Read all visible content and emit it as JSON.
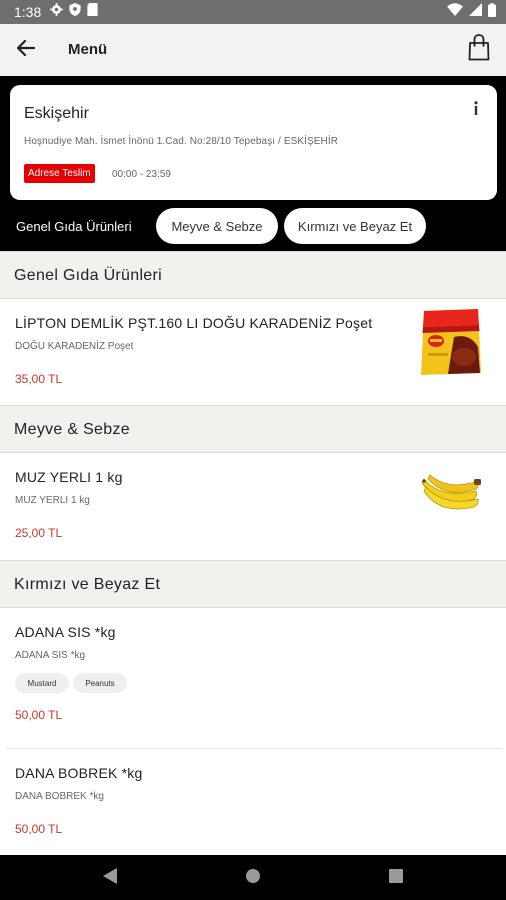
{
  "status_bar": {
    "time": "1:38",
    "icons_left": [
      "gear-icon",
      "shield-icon",
      "sim-card-icon"
    ],
    "icons_right": [
      "wifi-icon",
      "signal-icon",
      "battery-icon"
    ]
  },
  "app_bar": {
    "title": "Menü",
    "back_icon": "arrow-left-icon",
    "cart_icon": "shopping-bag-icon"
  },
  "store": {
    "name": "Eskişehir",
    "address": "Hoşnudiye Mah. İsmet İnönü 1.Cad. No:28/10  Tepebaşı / ESKİŞEHİR",
    "delivery_label": "Adrese Teslim",
    "hours": "00:00 - 23:59",
    "info_icon": "info-icon"
  },
  "categories": [
    {
      "label": "Genel Gıda Ürünleri",
      "selected": true
    },
    {
      "label": "Meyve & Sebze",
      "selected": false
    },
    {
      "label": "Kırmızı ve Beyaz Et",
      "selected": false
    }
  ],
  "sections": [
    {
      "title": "Genel Gıda Ürünleri",
      "products": [
        {
          "name": "LİPTON DEMLİK PŞT.160 LI DOĞU KARADENİZ Poşet",
          "description": "DOĞU KARADENİZ Poşet",
          "price": "35,00 TL",
          "image": "tea-package-image",
          "tags": []
        }
      ]
    },
    {
      "title": "Meyve & Sebze",
      "products": [
        {
          "name": "MUZ YERLI 1 kg",
          "description": "MUZ YERLI 1 kg",
          "price": "25,00 TL",
          "image": "banana-image",
          "tags": []
        }
      ]
    },
    {
      "title": "Kırmızı ve Beyaz Et",
      "products": [
        {
          "name": "ADANA SIS *kg",
          "description": "ADANA SIS *kg",
          "price": "50,00 TL",
          "tags": [
            "Mustard",
            "Peanuts"
          ]
        },
        {
          "name": "DANA BOBREK *kg",
          "description": "DANA BOBREK *kg",
          "price": "50,00 TL",
          "tags": []
        }
      ]
    }
  ],
  "colors": {
    "accent_red": "#e40000",
    "price_red": "#c0392b",
    "header_bg": "#f3f1ee",
    "app_bar_bg": "#f2f2f2",
    "dark_bg": "#000000"
  },
  "nav_bar": {
    "icons": [
      "back-triangle-icon",
      "home-circle-icon",
      "recents-square-icon"
    ]
  }
}
